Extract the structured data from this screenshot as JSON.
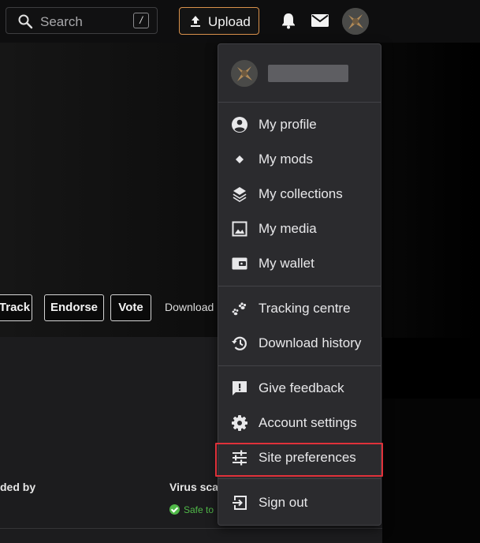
{
  "header": {
    "search_placeholder": "Search",
    "search_shortcut": "/",
    "upload_label": "Upload"
  },
  "page": {
    "actions": [
      "Track",
      "Endorse",
      "Vote"
    ],
    "downloads_label": "Download",
    "uploaded_by_label": "ded by",
    "virus_scan_label": "Virus sca",
    "safe_label": "Safe to"
  },
  "menu": {
    "items": [
      {
        "label": "My profile",
        "icon": "user-circle-icon"
      },
      {
        "label": "My mods",
        "icon": "diamond-icon"
      },
      {
        "label": "My collections",
        "icon": "layers-icon"
      },
      {
        "label": "My media",
        "icon": "image-icon"
      },
      {
        "label": "My wallet",
        "icon": "wallet-icon"
      },
      {
        "label": "Tracking centre",
        "icon": "paw-prints-icon"
      },
      {
        "label": "Download history",
        "icon": "history-icon"
      },
      {
        "label": "Give feedback",
        "icon": "feedback-icon"
      },
      {
        "label": "Account settings",
        "icon": "gear-icon"
      },
      {
        "label": "Site preferences",
        "icon": "sliders-icon"
      },
      {
        "label": "Sign out",
        "icon": "sign-out-icon"
      }
    ],
    "highlighted_item": "Site preferences"
  },
  "colors": {
    "upload_border": "#d9914b",
    "highlight_border": "#e0313a",
    "safe_green": "#50b848",
    "menu_bg": "#2b2b2e"
  }
}
